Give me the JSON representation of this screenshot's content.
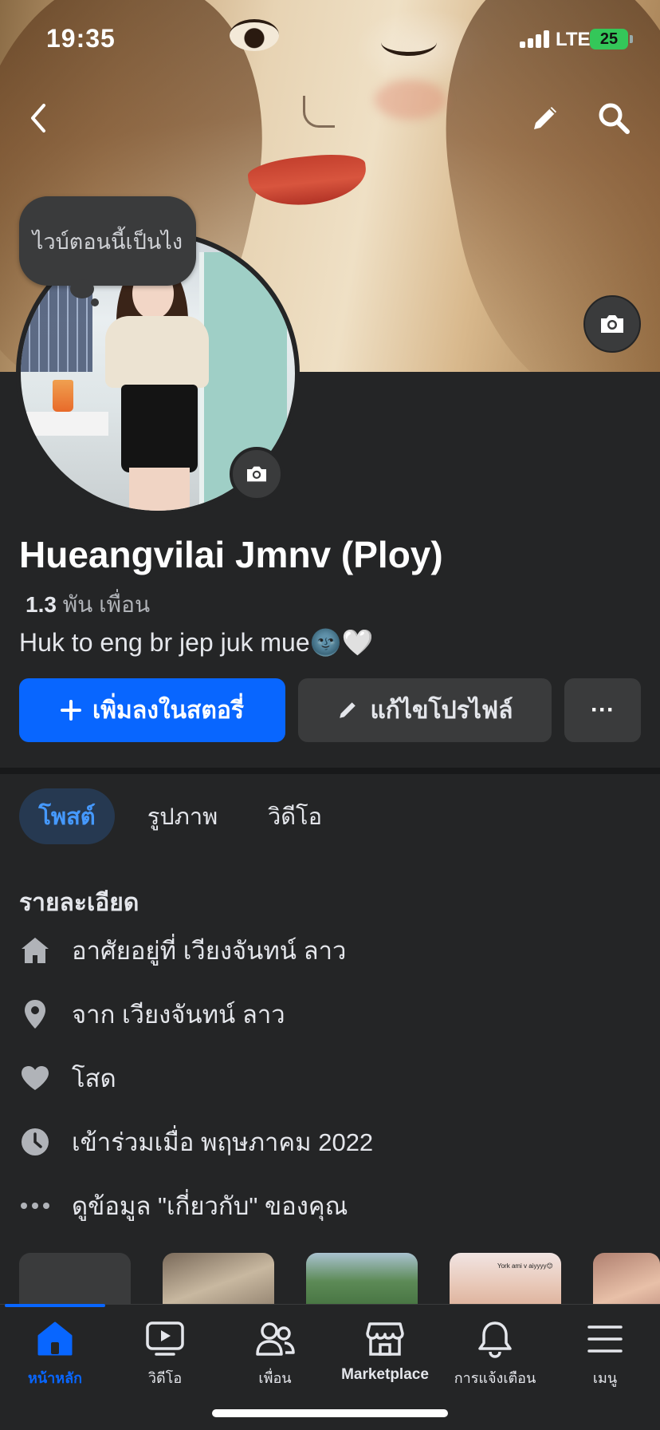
{
  "status_bar": {
    "time": "19:35",
    "network": "LTE",
    "battery": "25"
  },
  "profile": {
    "cover_note": "ไวบ์ตอนนี้เป็นไง",
    "name": "Hueangvilai Jmnv (Ploy)",
    "friends_count": "1.3",
    "friends_unit": "พัน เพื่อน",
    "bio": "Huk to eng br jep juk mue🌚🤍"
  },
  "actions": {
    "add_story": "เพิ่มลงในสตอรี่",
    "edit_profile": "แก้ไขโปรไฟล์",
    "more": "···"
  },
  "tabs": [
    {
      "label": "โพสต์",
      "active": true
    },
    {
      "label": "รูปภาพ",
      "active": false
    },
    {
      "label": "วิดีโอ",
      "active": false
    }
  ],
  "details": {
    "title": "รายละเอียด",
    "items": [
      {
        "icon": "home-icon",
        "text": "อาศัยอยู่ที่ เวียงจันทน์ ลาว"
      },
      {
        "icon": "location-pin-icon",
        "text": "จาก เวียงจันทน์ ลาว"
      },
      {
        "icon": "heart-icon",
        "text": "โสด"
      },
      {
        "icon": "clock-icon",
        "text": "เข้าร่วมเมื่อ พฤษภาคม 2022"
      },
      {
        "icon": "more-dots-icon",
        "text": "ดูข้อมูล \"เกี่ยวกับ\" ของคุณ"
      }
    ]
  },
  "photo_strip": {
    "thumb4_caption": "York ami v aiyyyy😊"
  },
  "bottom_nav": [
    {
      "icon": "home-icon",
      "label": "หน้าหลัก",
      "active": true
    },
    {
      "icon": "video-icon",
      "label": "วิดีโอ",
      "active": false
    },
    {
      "icon": "friends-icon",
      "label": "เพื่อน",
      "active": false
    },
    {
      "icon": "marketplace-icon",
      "label": "Marketplace",
      "active": false
    },
    {
      "icon": "bell-icon",
      "label": "การแจ้งเตือน",
      "active": false
    },
    {
      "icon": "menu-icon",
      "label": "เมนู",
      "active": false
    }
  ],
  "colors": {
    "accent": "#0866ff",
    "background": "#242526",
    "surface": "#3a3b3c",
    "text": "#e4e6eb",
    "muted": "#b0b3b8"
  }
}
